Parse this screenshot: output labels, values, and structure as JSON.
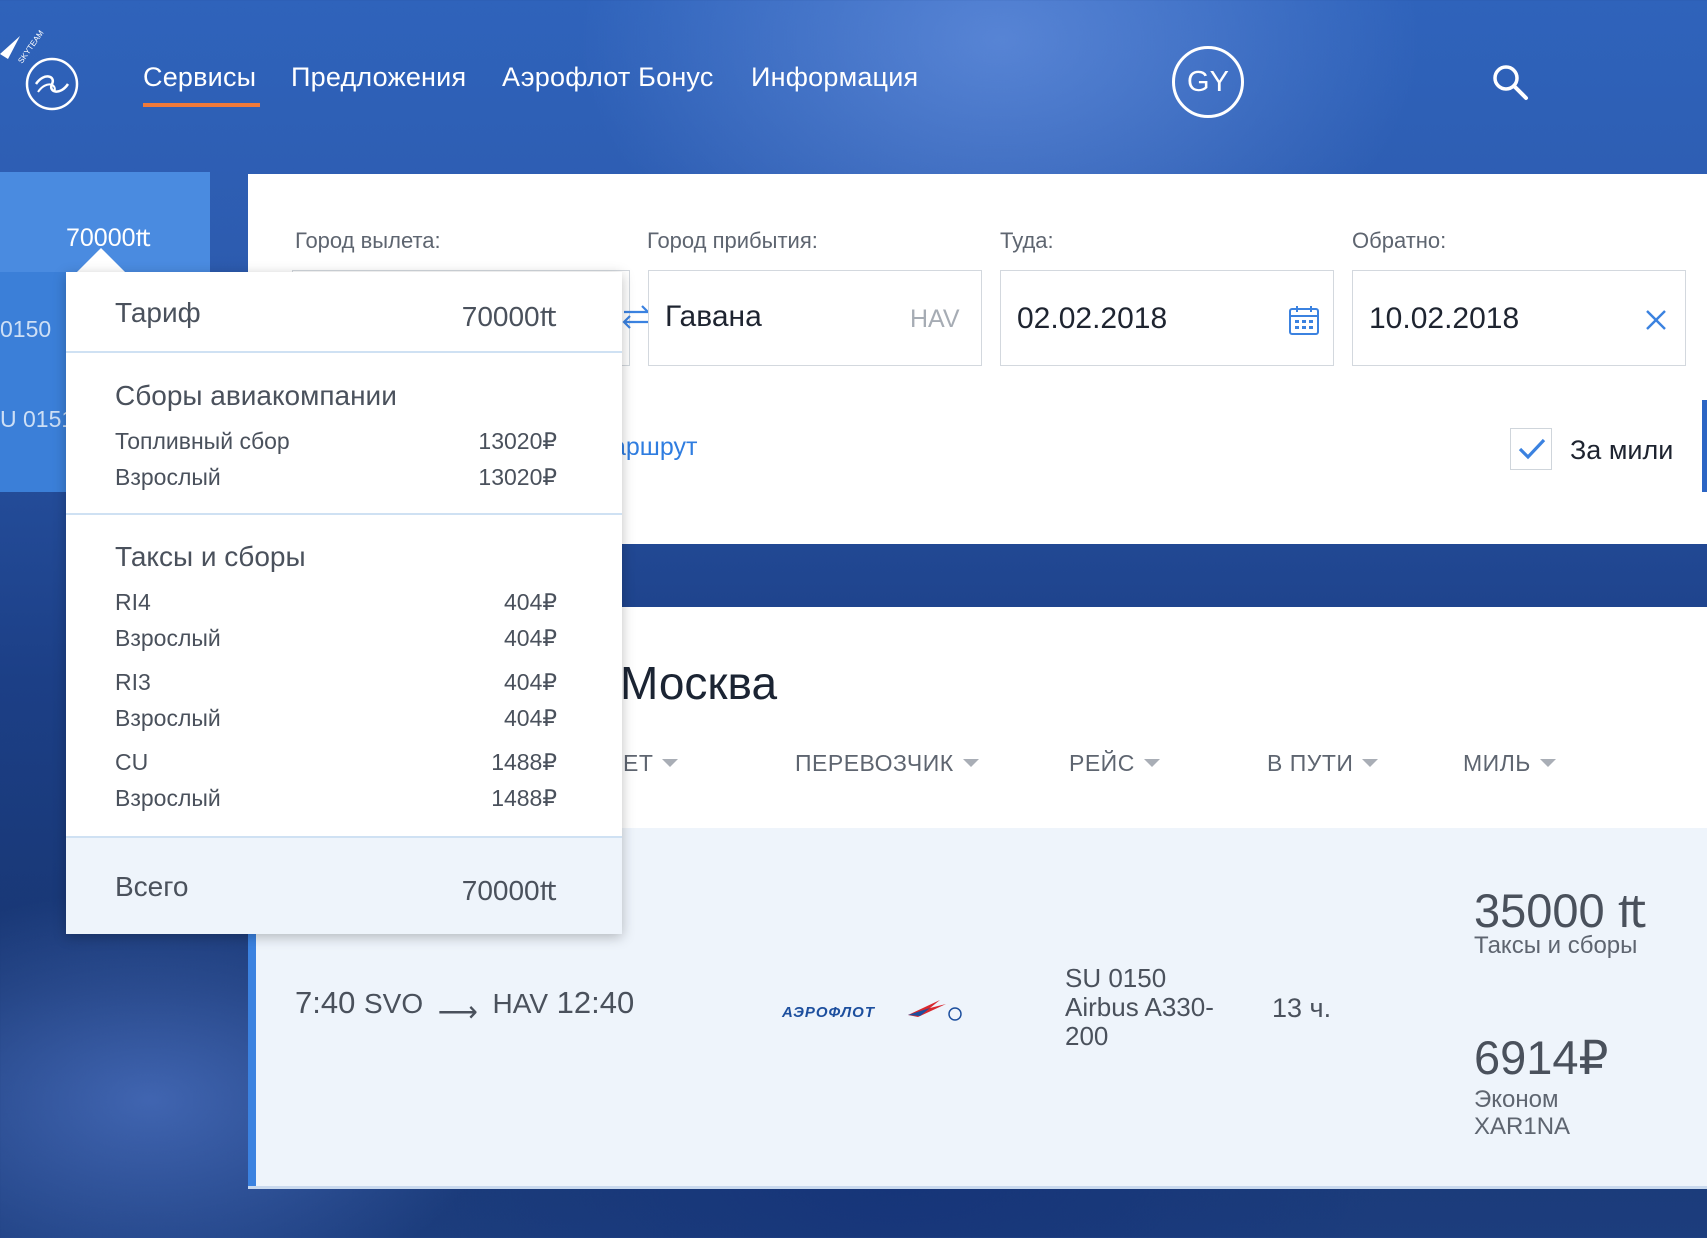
{
  "header": {
    "logo_text": "SKYTEAM",
    "nav": [
      "Сервисы",
      "Предложения",
      "Аэрофлот Бонус",
      "Информация"
    ],
    "avatar_initials": "GY",
    "accent_color": "#f07a3a"
  },
  "side_column": {
    "price": "70000₶",
    "flights": [
      "0150",
      "U 0151"
    ]
  },
  "search_form": {
    "from_label": "Город вылета:",
    "to_label": "Город прибытия:",
    "to_value": "Гавана",
    "to_code": "HAV",
    "depart_label": "Туда:",
    "depart_value": "02.02.2018",
    "return_label": "Обратно:",
    "return_value": "10.02.2018",
    "route_link": "аршрут",
    "miles_checkbox_label": "За мили",
    "miles_checked": true
  },
  "results": {
    "title": "Москва",
    "columns": [
      "ЕТ",
      "ПЕРЕВОЗЧИК",
      "РЕЙС",
      "В ПУТИ",
      "МИЛЬ"
    ],
    "row": {
      "depart_time": "7:40",
      "depart_code": "SVO",
      "arrive_code": "HAV",
      "arrive_time": "12:40",
      "carrier": "АЭРОФЛОТ",
      "flight_no": "SU 0150",
      "aircraft": "Airbus A330-200",
      "duration": "13 ч.",
      "miles_price": "35000 ₶",
      "miles_sub": "Таксы и сборы",
      "rub_price": "6914₽",
      "fare_class": "Эконом",
      "fare_code": "XAR1NA"
    }
  },
  "fare_popover": {
    "tariff_label": "Тариф",
    "tariff_value": "70000₶",
    "airline_fees_title": "Сборы авиакомпании",
    "airline_fees": [
      {
        "label": "Топливный сбор",
        "value": "13020₽"
      },
      {
        "label": "Взрослый",
        "value": "13020₽"
      }
    ],
    "taxes_title": "Таксы и сборы",
    "taxes": [
      {
        "label": "RI4",
        "value": "404₽"
      },
      {
        "label": "Взрослый",
        "value": "404₽"
      },
      {
        "label": "RI3",
        "value": "404₽"
      },
      {
        "label": "Взрослый",
        "value": "404₽"
      },
      {
        "label": "CU",
        "value": "1488₽"
      },
      {
        "label": "Взрослый",
        "value": "1488₽"
      }
    ],
    "total_label": "Всего",
    "total_value": "70000₶"
  }
}
